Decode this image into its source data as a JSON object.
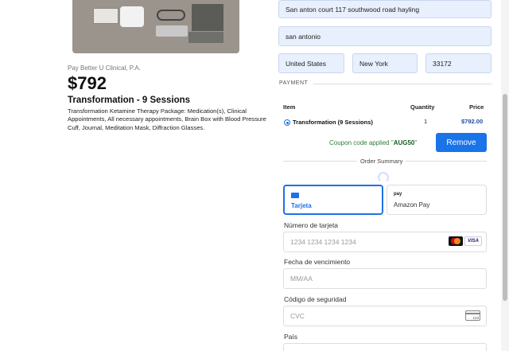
{
  "product": {
    "image_alt": "Ketamine therapy package contents",
    "company": "Pay Better U Clinical, P.A.",
    "price": "$792",
    "title": "Transformation - 9 Sessions",
    "description": "Transformation Ketamine Therapy Package: Medication(s), Clinical Appointments, All necessary appointments, Brain Box with Blood Pressure Cuff, Journal, Meditation Mask, Diffraction Glasses."
  },
  "address": {
    "line1": "San anton court 117 southwood road hayling",
    "city": "san antonio",
    "country": "United States",
    "state": "New York",
    "zip": "33172"
  },
  "payment_section": {
    "label": "PAYMENT"
  },
  "order_table": {
    "headers": {
      "item": "Item",
      "quantity": "Quantity",
      "price": "Price"
    },
    "rows": [
      {
        "name": "Transformation (9 Sessions)",
        "quantity": "1",
        "price": "$792.00"
      }
    ]
  },
  "coupon": {
    "prefix": "Coupon code applied \"",
    "code": "AUG50",
    "suffix": "\"",
    "remove_label": "Remove"
  },
  "order_summary": {
    "label": "Order Summary"
  },
  "payment_methods": {
    "card": {
      "label": "Tarjeta",
      "icon": "credit-card-icon"
    },
    "amazon": {
      "label": "Amazon Pay",
      "icon": "amazon-pay-icon",
      "icon_text": "pay"
    }
  },
  "card_form": {
    "number_label": "Número de tarjeta",
    "number_placeholder": "1234 1234 1234 1234",
    "expiry_label": "Fecha de vencimiento",
    "expiry_placeholder": "MM/AA",
    "cvc_label": "Código de seguridad",
    "cvc_placeholder": "CVC",
    "cvc_icon_text": "123",
    "country_label": "País",
    "brands": {
      "visa": "VISA"
    }
  },
  "colors": {
    "accent": "#1a73e8",
    "coupon_green": "#2e7d32",
    "autofill_bg": "#e8f0fe"
  }
}
